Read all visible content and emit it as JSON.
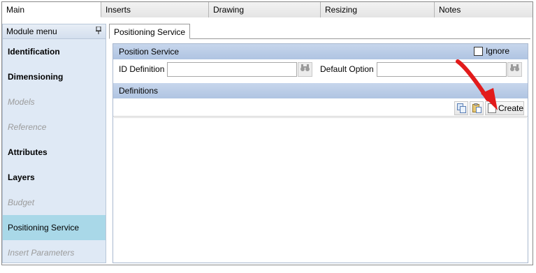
{
  "top_tabs": [
    "Main",
    "Inserts",
    "Drawing",
    "Resizing",
    "Notes"
  ],
  "sidebar": {
    "title": "Module menu",
    "pin_glyph": "ᵖ",
    "items": [
      {
        "label": "Identification",
        "state": "bold"
      },
      {
        "label": "Dimensioning",
        "state": "bold"
      },
      {
        "label": "Models",
        "state": "disabled"
      },
      {
        "label": "Reference",
        "state": "disabled"
      },
      {
        "label": "Attributes",
        "state": "bold"
      },
      {
        "label": "Layers",
        "state": "bold"
      },
      {
        "label": "Budget",
        "state": "disabled"
      },
      {
        "label": "Positioning Service",
        "state": "selected"
      },
      {
        "label": "Insert Parameters",
        "state": "disabled"
      }
    ]
  },
  "content": {
    "sub_tab": "Positioning Service",
    "position_service": {
      "title": "Position Service",
      "ignore_label": "Ignore",
      "id_definition_label": "ID Definition",
      "id_definition_value": "",
      "default_option_label": "Default Option",
      "default_option_value": ""
    },
    "definitions": {
      "title": "Definitions",
      "create_label": "Create"
    }
  },
  "colors": {
    "band": "#b9cbe6",
    "sidebar_bg": "#dfe9f5",
    "selected": "#a9d8e8",
    "arrow": "#e21b1b"
  },
  "icons": [
    "pin-icon",
    "binoculars-icon",
    "copy-icon",
    "paste-icon",
    "new-document-icon",
    "red-arrow-annotation"
  ]
}
